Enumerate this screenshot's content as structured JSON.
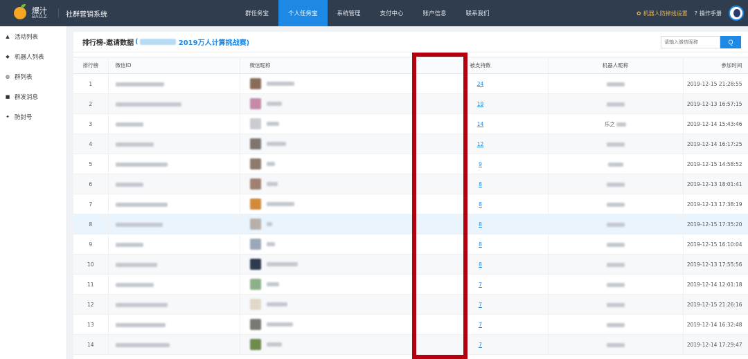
{
  "topbar": {
    "brand_cn": "爆汁",
    "brand_en": "BAO.Z",
    "system_name": "社群营销系统",
    "nav": [
      "群任务宝",
      "个人任务宝",
      "系统管理",
      "支付中心",
      "账户信息",
      "联系我们"
    ],
    "active_nav_index": 1,
    "right_links": [
      "机器人防掉线设置",
      "操作手册"
    ]
  },
  "sidebar": {
    "items": [
      {
        "label": "活动列表",
        "icon": "home-icon"
      },
      {
        "label": "机器人列表",
        "icon": "robot-icon"
      },
      {
        "label": "群列表",
        "icon": "group-icon"
      },
      {
        "label": "群发消息",
        "icon": "message-icon"
      },
      {
        "label": "防封号",
        "icon": "shield-icon"
      }
    ]
  },
  "main": {
    "title": "排行榜-邀请数据",
    "campaign_paren_open": "(",
    "campaign_title": "2019万人计算挑战赛)",
    "search_placeholder": "请输入微信昵称",
    "search_button": "Q"
  },
  "table": {
    "headers": [
      "排行榜",
      "微信ID",
      "微信昵称",
      "被支持数",
      "机器人昵称",
      "参加时间"
    ],
    "rows": [
      {
        "rank": "1",
        "support": "24",
        "time": "2019-12-15 21:28:55",
        "bot_text": ""
      },
      {
        "rank": "2",
        "support": "19",
        "time": "2019-12-13 16:57:15",
        "bot_text": ""
      },
      {
        "rank": "3",
        "support": "14",
        "time": "2019-12-14 15:43:46",
        "bot_text": "乐之"
      },
      {
        "rank": "4",
        "support": "12",
        "time": "2019-12-14 16:17:25",
        "bot_text": ""
      },
      {
        "rank": "5",
        "support": "9",
        "time": "2019-12-15 14:58:52",
        "bot_text": ""
      },
      {
        "rank": "6",
        "support": "8",
        "time": "2019-12-13 18:01:41",
        "bot_text": ""
      },
      {
        "rank": "7",
        "support": "8",
        "time": "2019-12-13 17:38:19",
        "bot_text": ""
      },
      {
        "rank": "8",
        "support": "8",
        "time": "2019-12-15 17:35:20",
        "bot_text": ""
      },
      {
        "rank": "9",
        "support": "8",
        "time": "2019-12-15 16:10:04",
        "bot_text": ""
      },
      {
        "rank": "10",
        "support": "8",
        "time": "2019-12-13 17:55:56",
        "bot_text": ""
      },
      {
        "rank": "11",
        "support": "7",
        "time": "2019-12-14 12:01:18",
        "bot_text": ""
      },
      {
        "rank": "12",
        "support": "7",
        "time": "2019-12-15 21:26:16",
        "bot_text": ""
      },
      {
        "rank": "13",
        "support": "7",
        "time": "2019-12-14 16:32:48",
        "bot_text": ""
      },
      {
        "rank": "14",
        "support": "7",
        "time": "2019-12-14 17:29:47",
        "bot_text": ""
      }
    ],
    "highlighted_row_index": 7
  },
  "colors": {
    "topbar": "#2f3d4f",
    "accent": "#1e88e5",
    "annotation_box": "#b50010"
  }
}
